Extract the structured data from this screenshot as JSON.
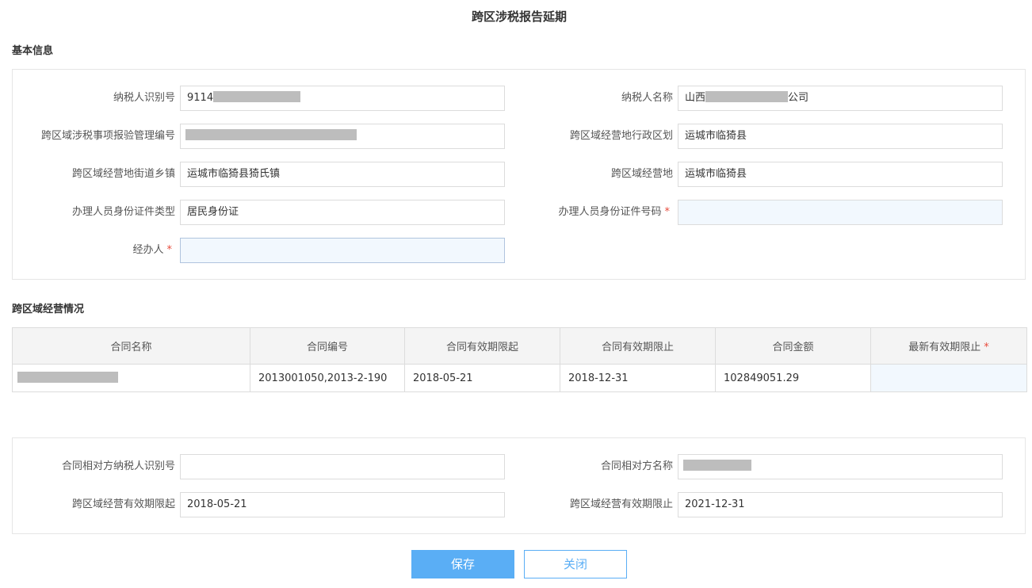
{
  "page": {
    "title": "跨区涉税报告延期"
  },
  "basic_info": {
    "section_title": "基本信息",
    "fields": [
      {
        "label": "纳税人识别号",
        "value_prefix": "9114",
        "value_suffix": "",
        "required": false
      },
      {
        "label": "纳税人名称",
        "value_prefix": "山西",
        "value_suffix": "公司",
        "required": false
      },
      {
        "label": "跨区域涉税事项报验管理编号",
        "value": "",
        "required": false
      },
      {
        "label": "跨区域经营地行政区划",
        "value": "运城市临猗县",
        "required": false
      },
      {
        "label": "跨区域经营地街道乡镇",
        "value": "运城市临猗县猗氏镇",
        "required": false
      },
      {
        "label": "跨区域经营地",
        "value": "运城市临猗县",
        "required": false
      },
      {
        "label": "办理人员身份证件类型",
        "value": "居民身份证",
        "required": false
      },
      {
        "label": "办理人员身份证件号码",
        "value": "",
        "required": true,
        "required_mark": "*"
      },
      {
        "label": "经办人",
        "value": "",
        "required": true,
        "required_mark": "*"
      }
    ]
  },
  "business": {
    "section_title": "跨区域经营情况",
    "columns": [
      "合同名称",
      "合同编号",
      "合同有效期限起",
      "合同有效期限止",
      "合同金额",
      "最新有效期限止"
    ],
    "required_mark": "*",
    "rows": [
      {
        "name": "",
        "number": "2013001050,2013-2-190",
        "start": "2018-05-21",
        "end": "2018-12-31",
        "amount": "102849051.29",
        "new_end": ""
      }
    ]
  },
  "contract_detail": {
    "fields": [
      {
        "label": "合同相对方纳税人识别号",
        "value": ""
      },
      {
        "label": "合同相对方名称",
        "value": ""
      },
      {
        "label": "跨区域经营有效期限起",
        "value": "2018-05-21"
      },
      {
        "label": "跨区域经营有效期限止",
        "value": "2021-12-31"
      }
    ]
  },
  "actions": {
    "save_label": "保存",
    "close_label": "关闭"
  },
  "colors": {
    "primary": "#5aaef5",
    "required": "#e84c3d",
    "editable_bg": "#f2f8fe",
    "border": "#dcdcdc",
    "header_bg": "#f4f4f4"
  }
}
